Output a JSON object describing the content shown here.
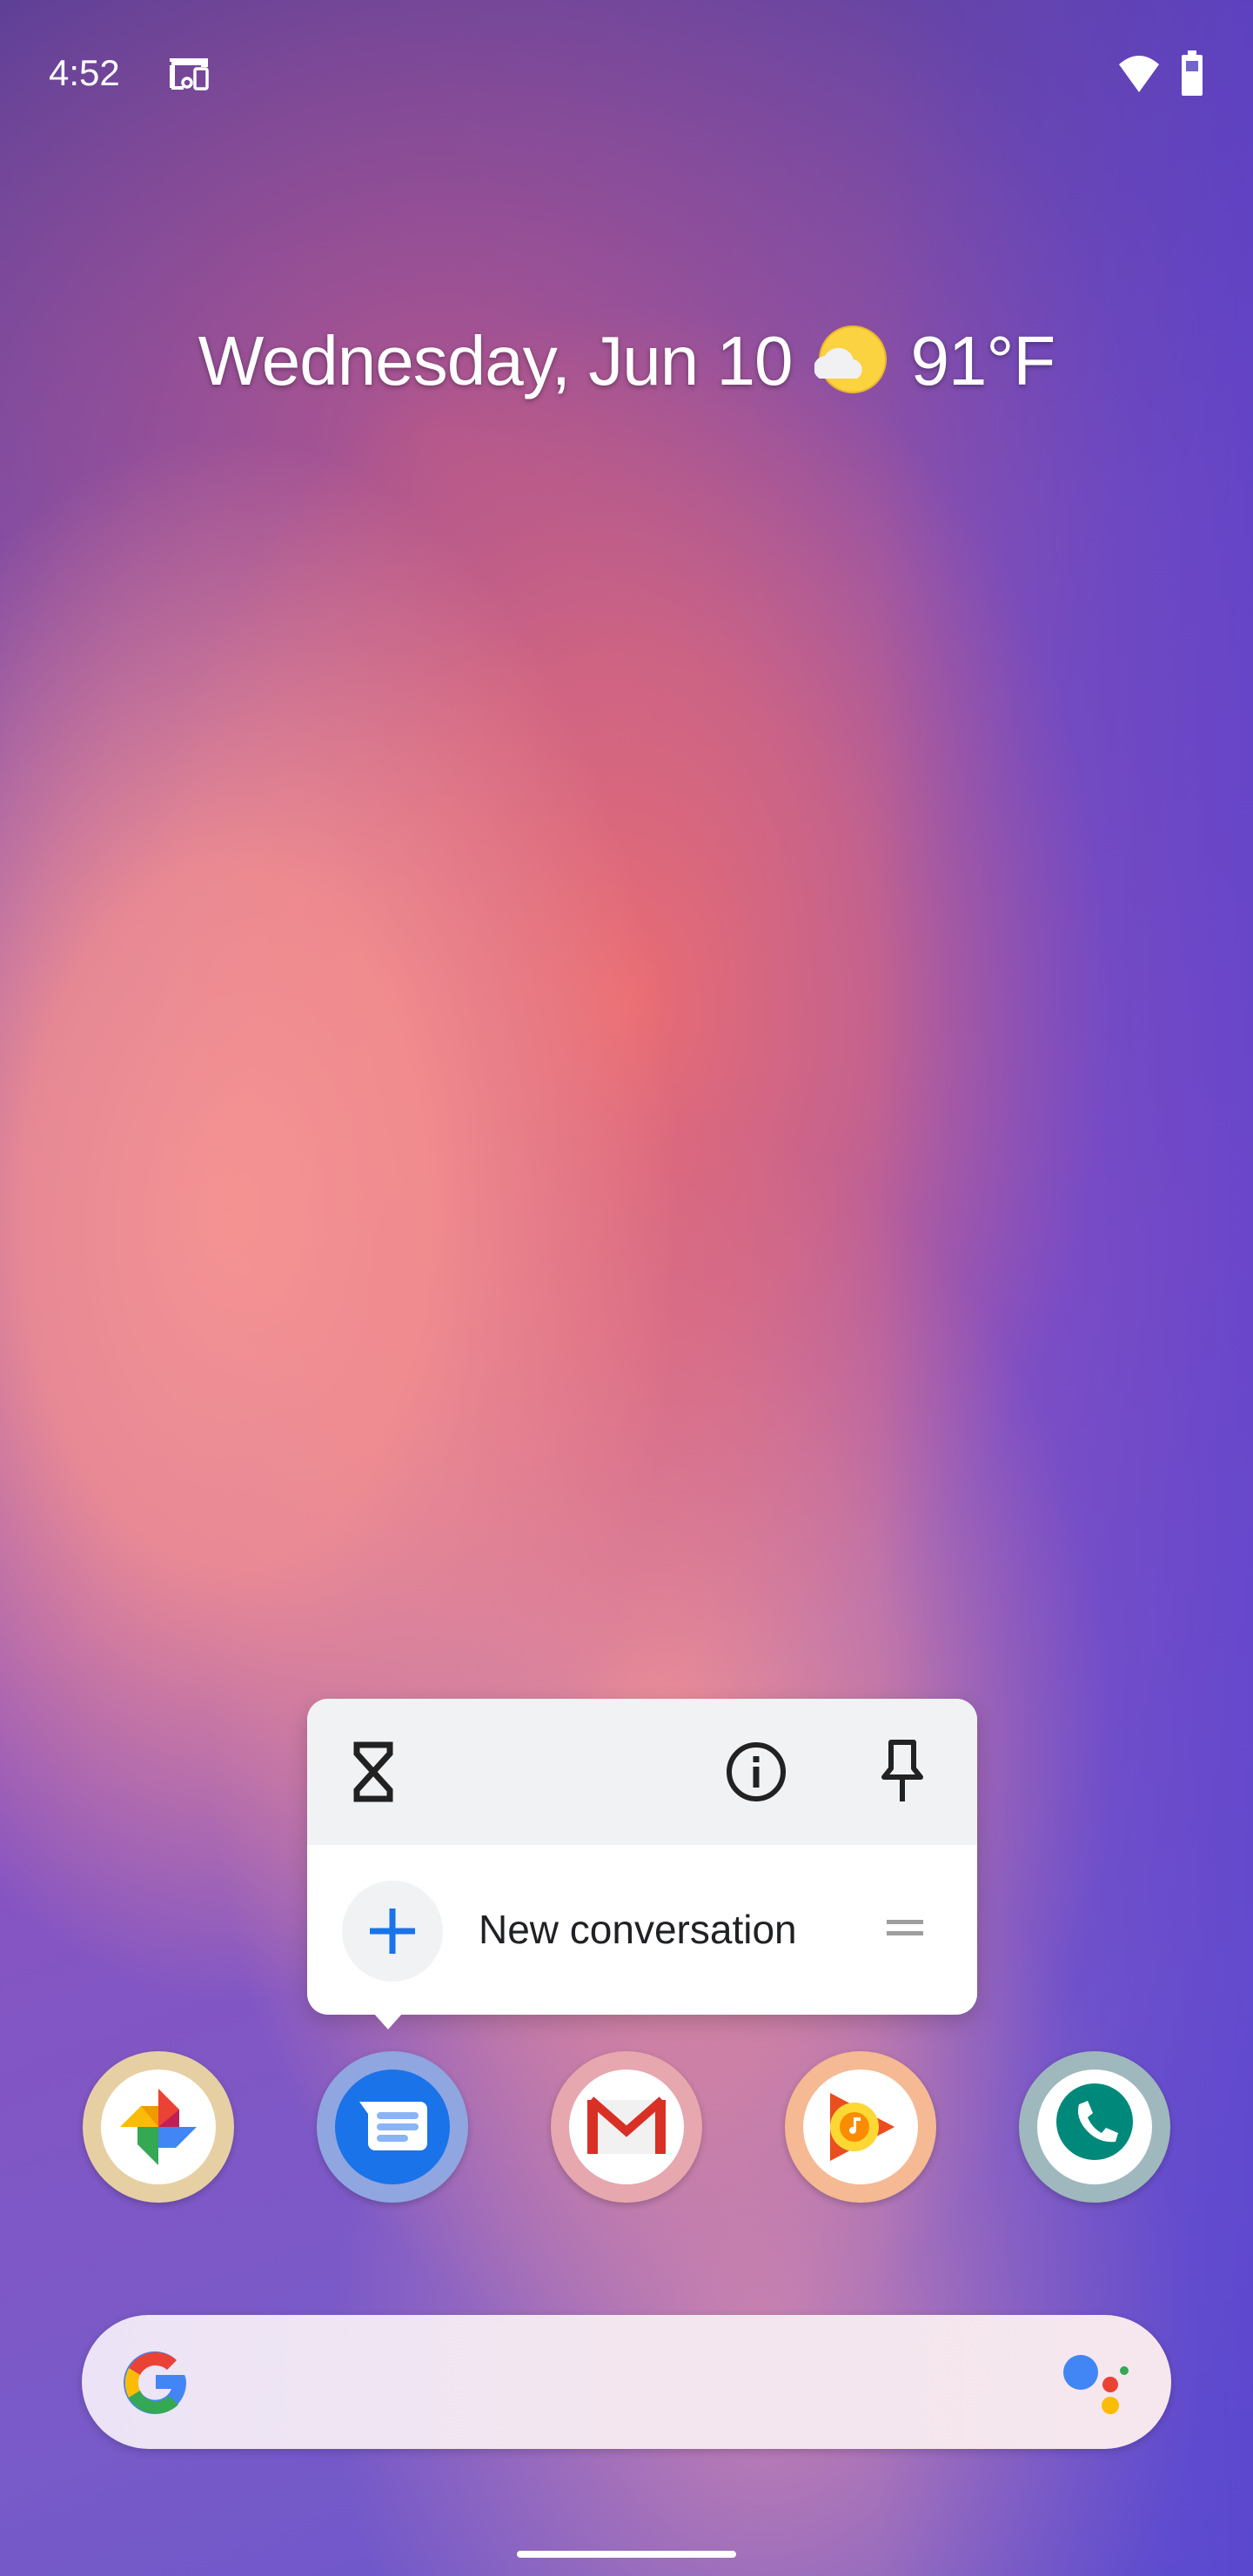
{
  "status_bar": {
    "time": "4:52",
    "icons": [
      "cast-screen-icon",
      "wifi-icon",
      "battery-icon"
    ]
  },
  "at_a_glance": {
    "date": "Wednesday, Jun 10",
    "weather_icon": "partly-cloudy-icon",
    "temperature": "91°F"
  },
  "shortcut_popup": {
    "app": "Messages",
    "system_actions": [
      {
        "name": "app-timer",
        "icon": "hourglass-icon"
      },
      {
        "name": "app-info",
        "icon": "info-icon"
      },
      {
        "name": "pin",
        "icon": "pin-icon"
      }
    ],
    "shortcuts": [
      {
        "label": "New conversation",
        "icon": "plus-icon",
        "accent": "#1a73e8"
      }
    ]
  },
  "hotseat": {
    "apps": [
      {
        "name": "Photos",
        "ring_color": "#e7cfa4"
      },
      {
        "name": "Messages",
        "ring_color": "#8fa6e0"
      },
      {
        "name": "Gmail",
        "ring_color": "#e6a7ae"
      },
      {
        "name": "Play Music",
        "ring_color": "#f5b993"
      },
      {
        "name": "Voice",
        "ring_color": "#9fb8bd"
      }
    ]
  },
  "search_bar": {
    "left_icon": "google-g-icon",
    "right_icon": "google-assistant-icon"
  },
  "colors": {
    "google_blue": "#4285f4",
    "google_red": "#ea4335",
    "google_yellow": "#fbbc05",
    "google_green": "#34a853"
  }
}
